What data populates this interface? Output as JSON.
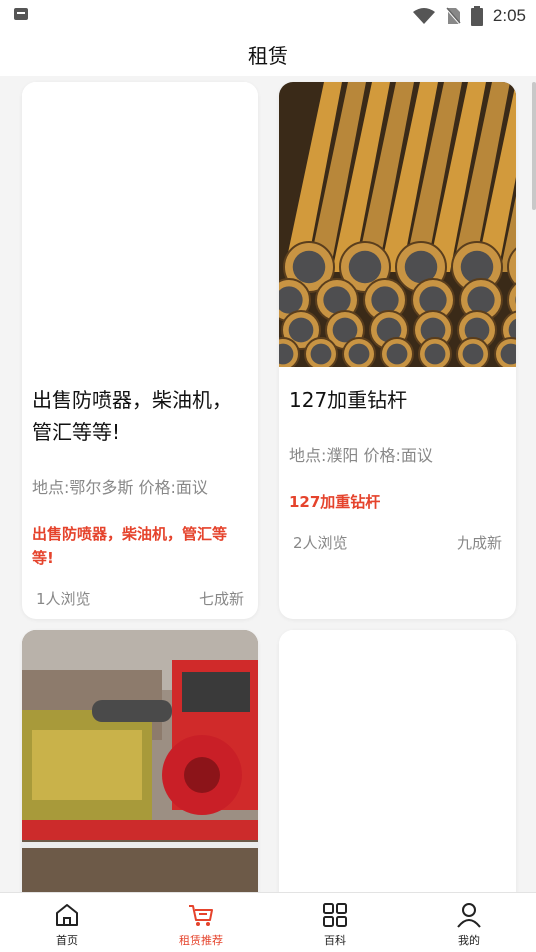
{
  "status_bar": {
    "time": "2:05"
  },
  "header": {
    "title": "租赁"
  },
  "listings": [
    {
      "title": "出售防喷器，柴油机，管汇等等!",
      "meta": "地点:鄂尔多斯 价格:面议",
      "description": "出售防喷器，柴油机，管汇等等!",
      "views": "1人浏览",
      "condition": "七成新",
      "has_image": false
    },
    {
      "title": "127加重钻杆",
      "meta": "地点:濮阳 价格:面议",
      "description": "127加重钻杆",
      "views": "2人浏览",
      "condition": "九成新",
      "has_image": true,
      "image": "stacked-drill-pipes"
    },
    {
      "has_image": true,
      "image": "red-machinery-on-truck"
    },
    {
      "has_image": false
    }
  ],
  "tab_bar": {
    "tabs": [
      {
        "label": "首页",
        "icon": "home-icon",
        "active": false
      },
      {
        "label": "租赁推荐",
        "icon": "cart-icon",
        "active": true
      },
      {
        "label": "百科",
        "icon": "grid-icon",
        "active": false
      },
      {
        "label": "我的",
        "icon": "user-icon",
        "active": false
      }
    ]
  },
  "colors": {
    "accent": "#e5432c",
    "background": "#f4f4f4",
    "card": "#ffffff"
  }
}
